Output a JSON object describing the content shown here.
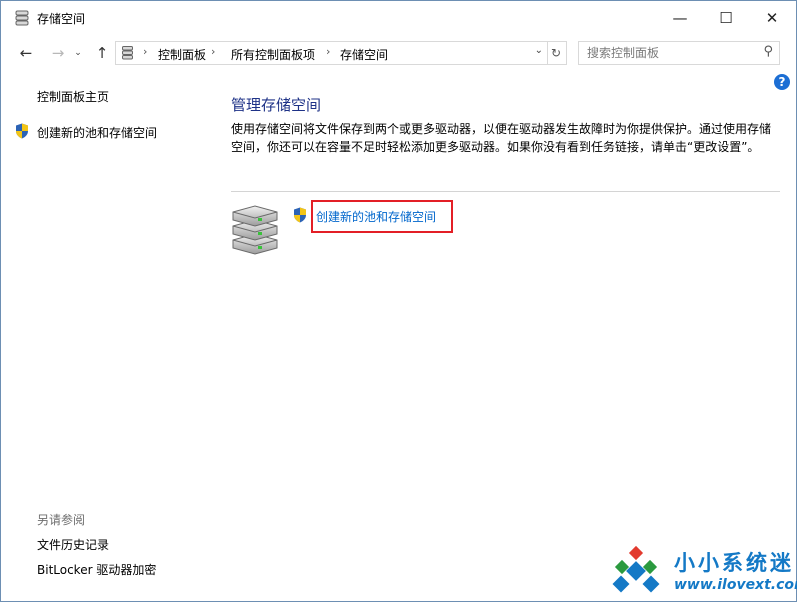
{
  "window": {
    "title": "存储空间",
    "minimize_glyph": "—",
    "maximize_glyph": "☐",
    "close_glyph": "✕"
  },
  "nav": {
    "back_glyph": "←",
    "forward_glyph": "→",
    "history_glyph": "⌄",
    "up_glyph": "↑",
    "breadcrumbs": [
      "控制面板",
      "所有控制面板项",
      "存储空间"
    ],
    "breadcrumb_separator": "›",
    "dropdown_glyph": "⌄",
    "refresh_glyph": "↻",
    "search_placeholder": "搜索控制面板",
    "search_value": "",
    "search_glyph": "⚲"
  },
  "help_glyph": "?",
  "left_pane": {
    "home_link": "控制面板主页",
    "create_link": "创建新的池和存储空间",
    "see_also_title": "另请参阅",
    "see_also_links": [
      "文件历史记录",
      "BitLocker 驱动器加密"
    ]
  },
  "main": {
    "heading": "管理存储空间",
    "description": "使用存储空间将文件保存到两个或更多驱动器，以便在驱动器发生故障时为你提供保护。通过使用存储空间，你还可以在容量不足时轻松添加更多驱动器。如果你没有看到任务链接，请单击“更改设置”。",
    "task_link": "创建新的池和存储空间"
  },
  "watermark": {
    "title": "小小系统迷",
    "url": "www.ilovext.com"
  },
  "colors": {
    "heading": "#1e3287",
    "link": "#0066cc",
    "highlight_box": "#e31f26",
    "watermark": "#1479c6"
  },
  "icons": {
    "title": "storage-spaces-icon",
    "address": "storage-spaces-icon",
    "shield": "uac-shield-icon",
    "drive": "drive-stack-icon",
    "watermark": "xiaoxiao-logo-icon"
  }
}
